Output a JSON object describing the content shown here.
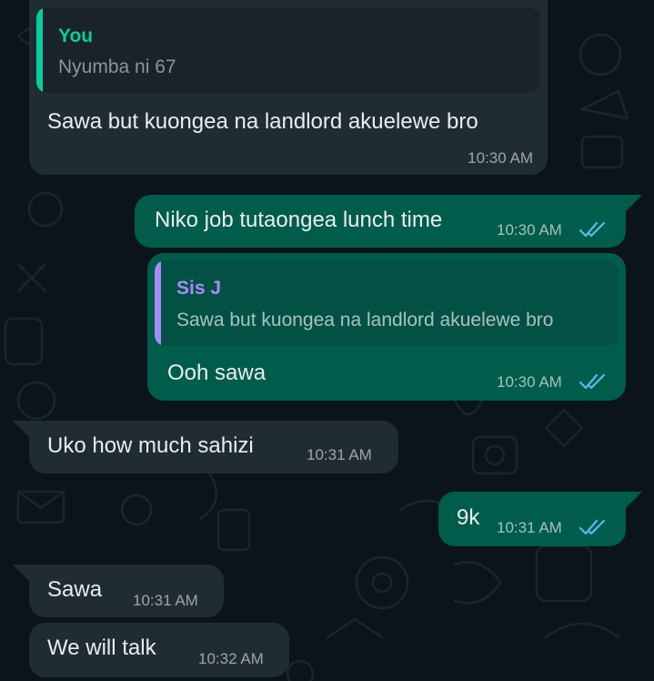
{
  "colors": {
    "background": "#0b141a",
    "incoming_bubble": "#202c33",
    "outgoing_bubble": "#005c4b",
    "quote_you_accent": "#06cf9c",
    "quote_sisj_accent": "#a78bfa",
    "read_ticks": "#53bdeb"
  },
  "messages": [
    {
      "direction": "incoming",
      "quote": {
        "author": "You",
        "text": "Nyumba ni 67"
      },
      "text": "Sawa but kuongea na landlord akuelewe bro",
      "time": "10:30 AM"
    },
    {
      "direction": "outgoing",
      "text": "Niko job tutaongea lunch time",
      "time": "10:30 AM",
      "status_icon": "double-check-read-icon"
    },
    {
      "direction": "outgoing",
      "quote": {
        "author": "Sis J",
        "text": "Sawa but kuongea na landlord akuelewe bro"
      },
      "text": "Ooh sawa",
      "time": "10:30 AM",
      "status_icon": "double-check-read-icon"
    },
    {
      "direction": "incoming",
      "text": "Uko how much sahizi",
      "time": "10:31 AM"
    },
    {
      "direction": "outgoing",
      "text": "9k",
      "time": "10:31 AM",
      "status_icon": "double-check-read-icon"
    },
    {
      "direction": "incoming",
      "text": "Sawa",
      "time": "10:31 AM"
    },
    {
      "direction": "incoming",
      "text": "We will talk",
      "time": "10:32 AM"
    }
  ]
}
